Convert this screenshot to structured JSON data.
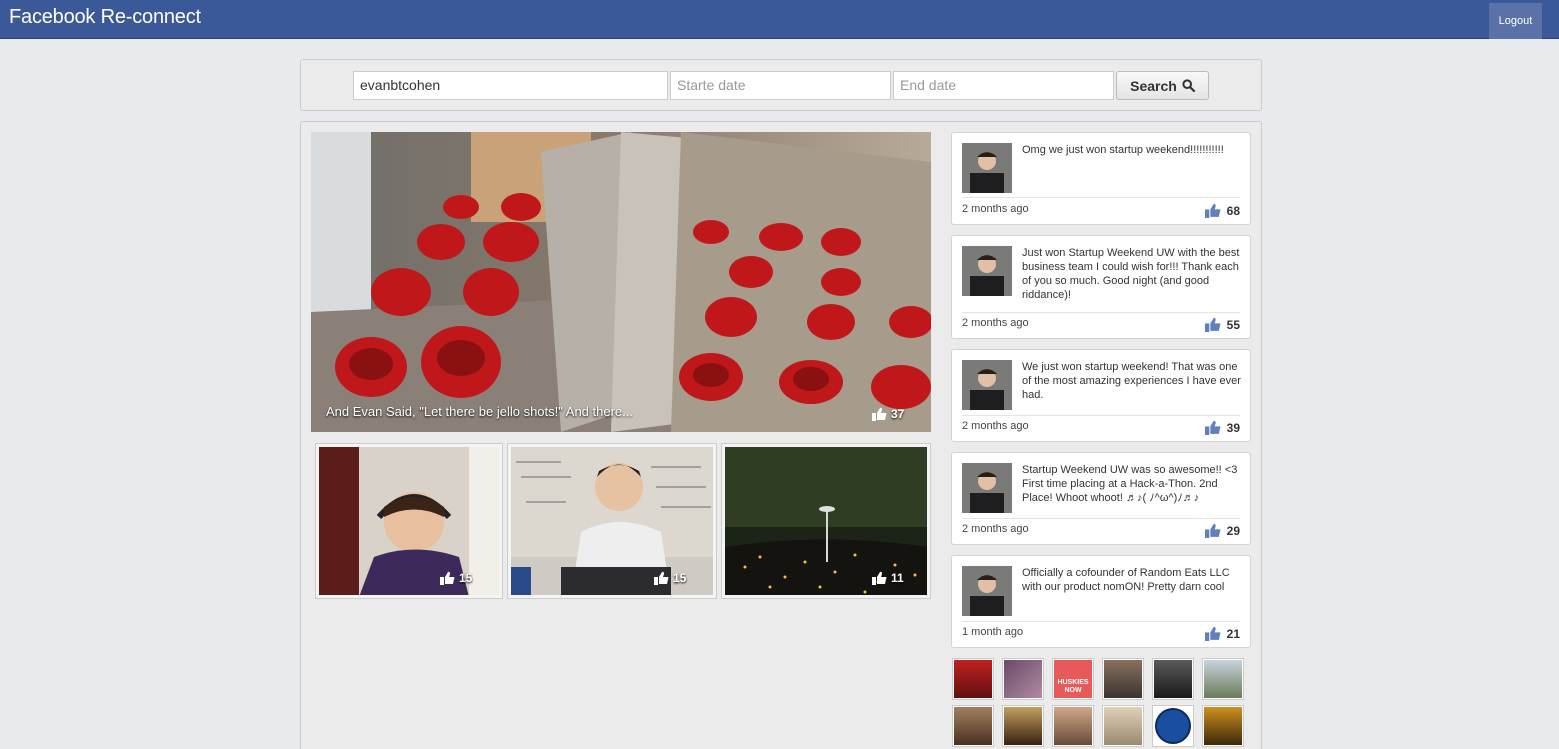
{
  "app": {
    "title": "Facebook Re-connect",
    "logout_label": "Logout",
    "brand_color": "#3b5998"
  },
  "search": {
    "username_value": "evanbtcohen",
    "start_placeholder": "Starte date",
    "end_placeholder": "End date",
    "button_label": "Search",
    "button_icon": "search-icon"
  },
  "photos": {
    "featured": {
      "caption": "And Evan Said, \"Let there be jello shots!\" And there...",
      "likes": "37"
    },
    "thumbnails": [
      {
        "likes": "15"
      },
      {
        "likes": "15"
      },
      {
        "likes": "11"
      }
    ]
  },
  "posts": [
    {
      "text": "Omg we just won startup weekend!!!!!!!!!!!",
      "time": "2 months ago",
      "likes": "68"
    },
    {
      "text": "Just won Startup Weekend UW with the best business team I could wish for!!! Thank each of you so much. Good night (and good riddance)!",
      "time": "2 months ago",
      "likes": "55"
    },
    {
      "text": "We just won startup weekend! That was one of the most amazing experiences I have ever had.",
      "time": "2 months ago",
      "likes": "39"
    },
    {
      "text": "Startup Weekend UW was so awesome!! <3 First time placing at a Hack-a-Thon. 2nd Place! Whoot whoot! ♬♪( ﾉ^ω^)ﾉ♬♪",
      "time": "2 months ago",
      "likes": "29"
    },
    {
      "text": "Officially a cofounder of Random Eats LLC with our product nomON! Pretty darn cool",
      "time": "1 month ago",
      "likes": "21"
    }
  ],
  "friends": {
    "row1_badge": "HUSKIES NOW"
  }
}
